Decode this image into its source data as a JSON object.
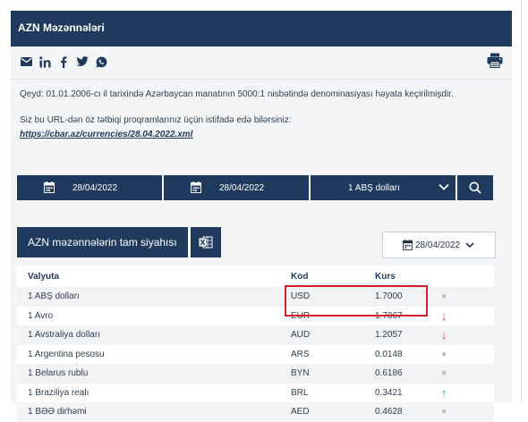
{
  "header": {
    "title": "AZN Məzənnələri"
  },
  "share": {
    "icons": [
      "mail-icon",
      "linkedin-icon",
      "facebook-icon",
      "twitter-icon",
      "whatsapp-icon"
    ],
    "print_icon": "printer-icon"
  },
  "note": "Qeyd: 01.01.2006-cı il tarixində Azərbaycan manatının 5000:1 nisbətində denominasiyası həyata keçirilmişdir.",
  "url_note": "Siz bu URL-dən öz tətbiqi proqramlarınız üçün istifadə edə bilərsiniz:",
  "url": "https://cbar.az/currencies/28.04.2022.xml",
  "filters": {
    "date_from": "28/04/2022",
    "date_to": "28/04/2022",
    "currency": "1 ABŞ dolları"
  },
  "table_tab": "AZN məzənnələrin tam siyahısı",
  "date_picker": "28/04/2022",
  "columns": {
    "currency": "Valyuta",
    "code": "Kod",
    "rate": "Kurs"
  },
  "rows": [
    {
      "name": "1 ABŞ dolları",
      "code": "USD",
      "rate": "1.7000",
      "trend": "same"
    },
    {
      "name": "1 Avro",
      "code": "EUR",
      "rate": "1.7867",
      "trend": "down"
    },
    {
      "name": "1 Avstraliya dolları",
      "code": "AUD",
      "rate": "1.2057",
      "trend": "down"
    },
    {
      "name": "1 Argentina pesosu",
      "code": "ARS",
      "rate": "0.0148",
      "trend": "same"
    },
    {
      "name": "1 Belarus rublu",
      "code": "BYN",
      "rate": "0.6186",
      "trend": "same"
    },
    {
      "name": "1 Braziliya realı",
      "code": "BRL",
      "rate": "0.3421",
      "trend": "up"
    },
    {
      "name": "1 BƏƏ dirhəmi",
      "code": "AED",
      "rate": "0.4628",
      "trend": "same"
    }
  ],
  "colors": {
    "primary": "#1f3a5c",
    "highlight": "#d1202c",
    "up": "#2aa44f",
    "down": "#e23434"
  }
}
